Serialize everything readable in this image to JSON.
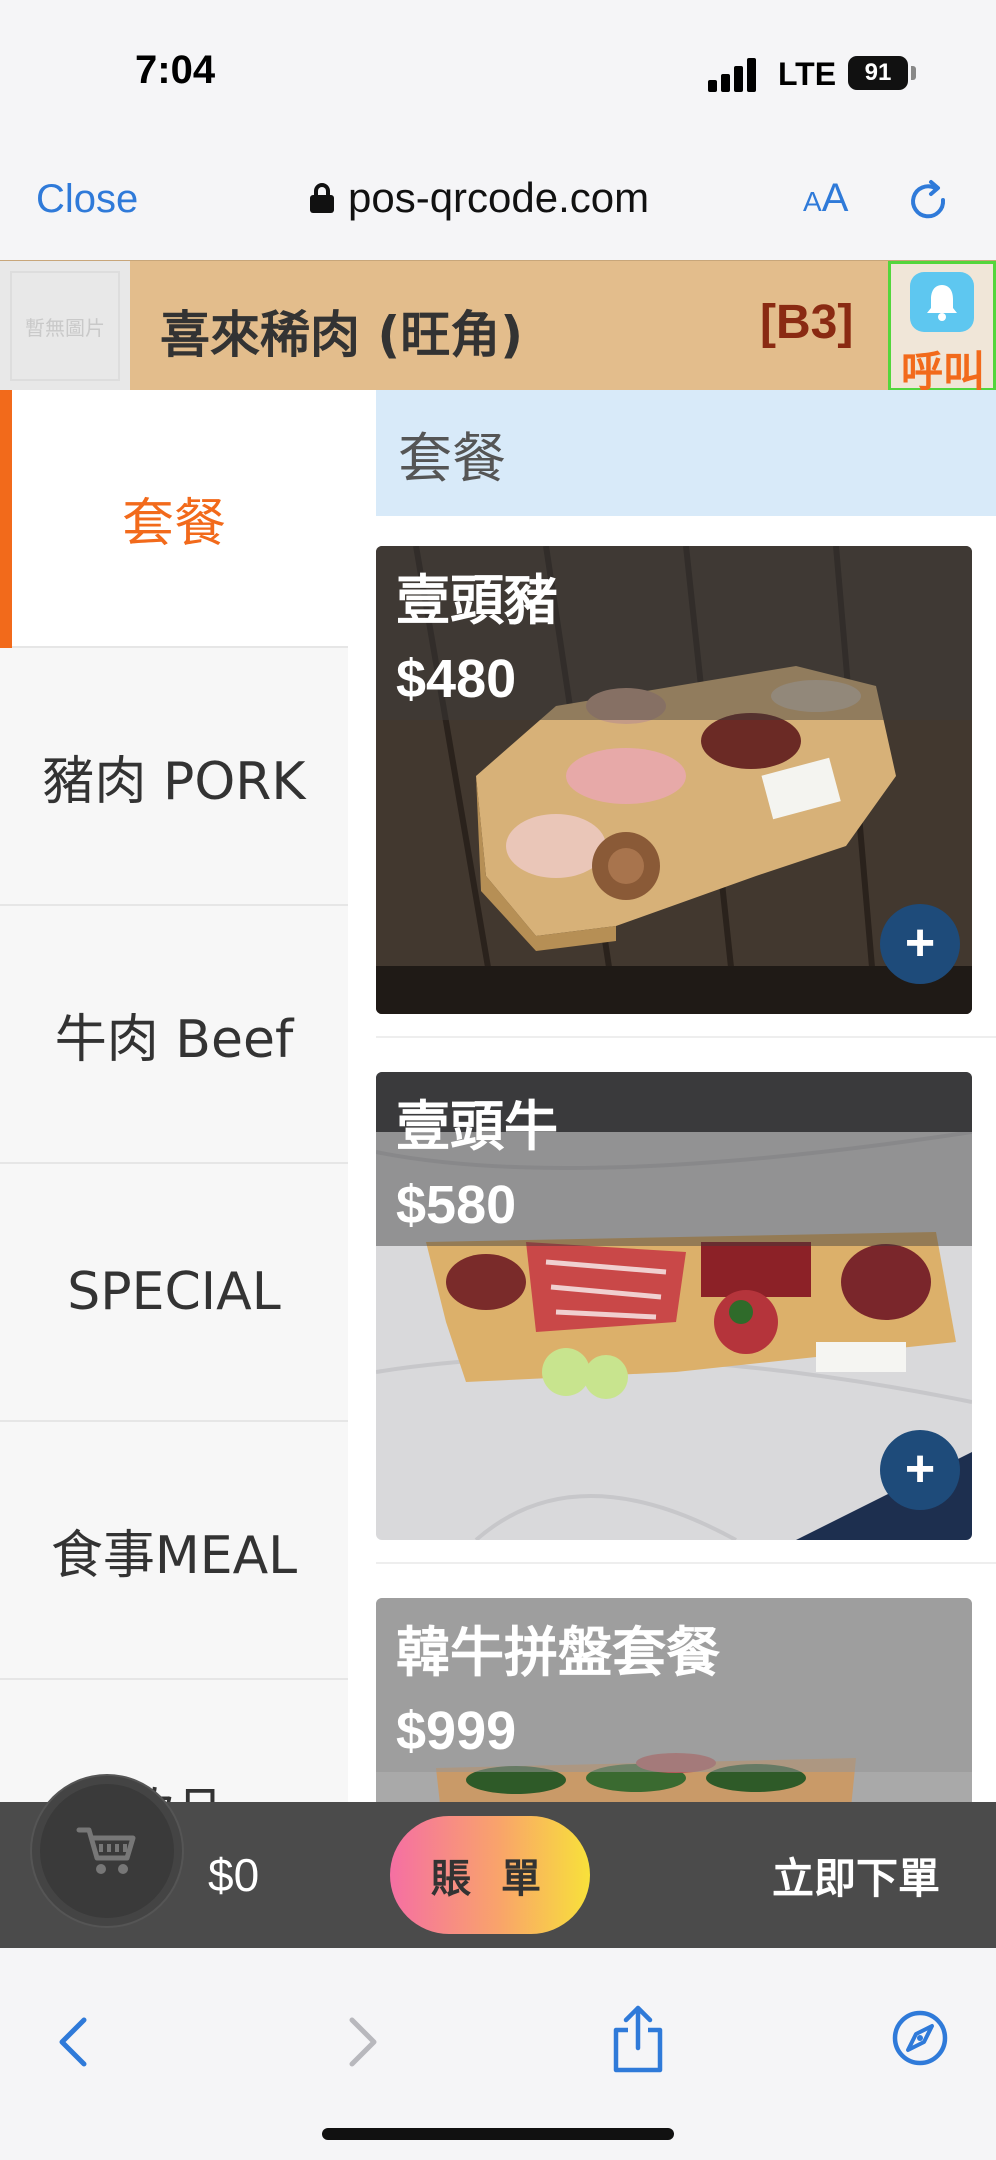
{
  "status_bar": {
    "time": "7:04",
    "network": "LTE",
    "battery": "91"
  },
  "browser": {
    "close_label": "Close",
    "url": "pos-qrcode.com",
    "aa_small": "A",
    "aa_big": "A"
  },
  "store": {
    "logo_text": "暫無圖片",
    "name": "喜來稀肉 (旺角)",
    "table": "[B3]",
    "call_label": "呼叫"
  },
  "categories": [
    {
      "label": "套餐",
      "active": true
    },
    {
      "label": "豬肉 PORK"
    },
    {
      "label": "牛肉 Beef"
    },
    {
      "label": "SPECIAL"
    },
    {
      "label": "食事MEAL"
    },
    {
      "label": "飲品"
    }
  ],
  "section": {
    "title": "套餐"
  },
  "products": [
    {
      "name": "壹頭豬",
      "price": "$480"
    },
    {
      "name": "壹頭牛",
      "price": "$580"
    },
    {
      "name": "韓牛拼盤套餐",
      "price": "$999"
    }
  ],
  "cart": {
    "total": "$0",
    "bill_label": "賬 單",
    "order_label": "立即下單"
  },
  "icons": {
    "add": "+",
    "cart": "cart-icon",
    "bell": "bell-icon"
  },
  "colors": {
    "accent": "#f26a1b",
    "link": "#2f7ad9",
    "store_header": "#e3bd8c",
    "add_button": "#1e4b7a"
  }
}
